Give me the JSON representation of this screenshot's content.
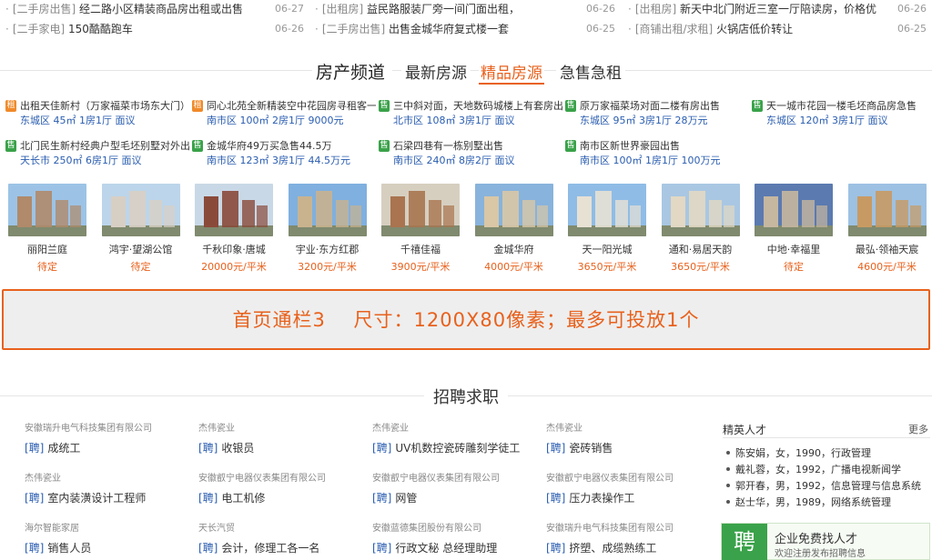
{
  "news": [
    {
      "tag": "[二手房出售]",
      "title": "经二路小区精装商品房出租或出售",
      "date": "06-27"
    },
    {
      "tag": "[出租房]",
      "title": "益民路服装厂旁一间门面出租，",
      "date": "06-26"
    },
    {
      "tag": "[出租房]",
      "title": "新天中北门附近三室一厅陪读房，价格优",
      "date": "06-26"
    },
    {
      "tag": "[二手家电]",
      "title": "150酷酷跑车",
      "date": "06-26"
    },
    {
      "tag": "[二手房出售]",
      "title": "出售金城华府复式楼一套",
      "date": "06-25"
    },
    {
      "tag": "[商铺出租/求租]",
      "title": "火锅店低价转让",
      "date": "06-25"
    }
  ],
  "channel": {
    "main": "房产频道",
    "tabs": [
      "最新房源",
      "精品房源",
      "急售急租"
    ],
    "active_tab_index": 1
  },
  "listings": [
    {
      "type": "租",
      "kind": "rent",
      "title": "出租天佳新村（万家福菜市场东大门）",
      "info": "东城区 45㎡ 1房1厅 面议"
    },
    {
      "type": "租",
      "kind": "rent",
      "title": "同心北苑全新精装空中花园房寻租客一",
      "info": "南市区 100㎡ 2房1厅 9000元"
    },
    {
      "type": "售",
      "kind": "sale",
      "title": "三中斜对面，天地数码城楼上有套房出",
      "info": "北市区 108㎡ 3房1厅 面议"
    },
    {
      "type": "售",
      "kind": "sale",
      "title": "原万家福菜场对面二楼有房出售",
      "info": "东城区 95㎡ 3房1厅 28万元"
    },
    {
      "type": "售",
      "kind": "sale",
      "title": "天一城市花园一楼毛坯商品房急售",
      "info": "东城区 120㎡ 3房1厅 面议"
    },
    {
      "type": "售",
      "kind": "sale",
      "title": "北门民生新村经典户型毛坯别墅对外出",
      "info": "天长市 250㎡ 6房1厅 面议"
    },
    {
      "type": "售",
      "kind": "sale",
      "title": "金城华府49万买急售44.5万",
      "info": "南市区 123㎡ 3房1厅 44.5万元"
    },
    {
      "type": "售",
      "kind": "sale",
      "title": "石梁四巷有一栋别墅出售",
      "info": "南市区 240㎡ 8房2厅 面议"
    },
    {
      "type": "售",
      "kind": "sale",
      "title": "南市区新世界豪园出售",
      "info": "南市区 100㎡ 1房1厅 100万元"
    }
  ],
  "properties": [
    {
      "name": "丽阳兰庭",
      "price": "待定",
      "sky": "#9cc3e6",
      "bldg": "#b08a6a"
    },
    {
      "name": "鸿宇·望湖公馆",
      "price": "待定",
      "sky": "#bcd5ea",
      "bldg": "#d8cfc4"
    },
    {
      "name": "千秋印象·唐城",
      "price": "20000元/平米",
      "sky": "#c9d8e6",
      "bldg": "#8a4a3a"
    },
    {
      "name": "宇业·东方红郡",
      "price": "3200元/平米",
      "sky": "#7fb0df",
      "bldg": "#c9b38f"
    },
    {
      "name": "千禧佳福",
      "price": "3900元/平米",
      "sky": "#d6cfc0",
      "bldg": "#a9744f"
    },
    {
      "name": "金城华府",
      "price": "4000元/平米",
      "sky": "#88b3dc",
      "bldg": "#d9c7a6"
    },
    {
      "name": "天一阳光城",
      "price": "3650元/平米",
      "sky": "#8fbce6",
      "bldg": "#e7e1d4"
    },
    {
      "name": "通和·易居天韵",
      "price": "3650元/平米",
      "sky": "#a9c7e2",
      "bldg": "#e2d8c4"
    },
    {
      "name": "中地·幸福里",
      "price": "待定",
      "sky": "#5b7ab0",
      "bldg": "#c6b7a0"
    },
    {
      "name": "最弘·领袖天宸",
      "price": "4600元/平米",
      "sky": "#9dc1e3",
      "bldg": "#c89a63"
    }
  ],
  "banner": {
    "text": "首页通栏3    尺寸：1200X80像素；最多可投放1个"
  },
  "recruit": {
    "title": "招聘求职",
    "zp": "[聘]",
    "jobs": [
      {
        "company": "安徽瑞升电气科技集团有限公司",
        "position": "成统工"
      },
      {
        "company": "杰伟瓷业",
        "position": "收银员"
      },
      {
        "company": "杰伟瓷业",
        "position": "UV机数控瓷砖雕刻学徒工"
      },
      {
        "company": "杰伟瓷业",
        "position": "瓷砖销售"
      },
      {
        "company": "杰伟瓷业",
        "position": "室内装潢设计工程师"
      },
      {
        "company": "安徽叡宁电器仪表集团有限公司",
        "position": "电工机修"
      },
      {
        "company": "安徽叡宁电器仪表集团有限公司",
        "position": "网管"
      },
      {
        "company": "安徽叡宁电器仪表集团有限公司",
        "position": "压力表操作工"
      },
      {
        "company": "海尔智能家居",
        "position": "销售人员"
      },
      {
        "company": "天长汽贸",
        "position": "会计，修理工各一名"
      },
      {
        "company": "安徽蓝德集团股份有限公司",
        "position": "行政文秘 总经理助理"
      },
      {
        "company": "安徽瑞升电气科技集团有限公司",
        "position": "挤塑、成缆熟练工"
      }
    ]
  },
  "talent": {
    "title": "精英人才",
    "more": "更多",
    "items": [
      "陈安娟，女，1990，行政管理",
      "戴礼蓉，女，1992，广播电视新闻学",
      "郭开春，男，1992，信息管理与信息系统",
      "赵士华，男，1989，网络系统管理"
    ]
  },
  "hire": {
    "icon": "聘",
    "line1": "企业免费找人才",
    "line2": "欢迎注册发布招聘信息"
  }
}
